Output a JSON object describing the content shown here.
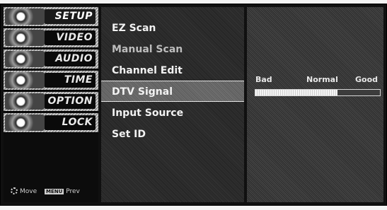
{
  "left_menu": {
    "items": [
      {
        "label": "SETUP",
        "icon": "setup-icon",
        "active": true
      },
      {
        "label": "VIDEO",
        "icon": "video-icon"
      },
      {
        "label": "AUDIO",
        "icon": "audio-icon"
      },
      {
        "label": "TIME",
        "icon": "time-icon"
      },
      {
        "label": "OPTION",
        "icon": "option-icon"
      },
      {
        "label": "LOCK",
        "icon": "lock-icon"
      }
    ],
    "nav_hint": {
      "move": "Move",
      "menu_key": "MENU",
      "prev": "Prev"
    }
  },
  "submenu": {
    "items": [
      {
        "label": "EZ Scan"
      },
      {
        "label": "Manual Scan"
      },
      {
        "label": "Channel Edit"
      },
      {
        "label": "DTV Signal",
        "selected": true
      },
      {
        "label": "Input Source"
      },
      {
        "label": "Set ID"
      }
    ]
  },
  "signal_panel": {
    "scale_labels": {
      "bad": "Bad",
      "normal": "Normal",
      "good": "Good"
    },
    "signal_level": 0.66
  }
}
